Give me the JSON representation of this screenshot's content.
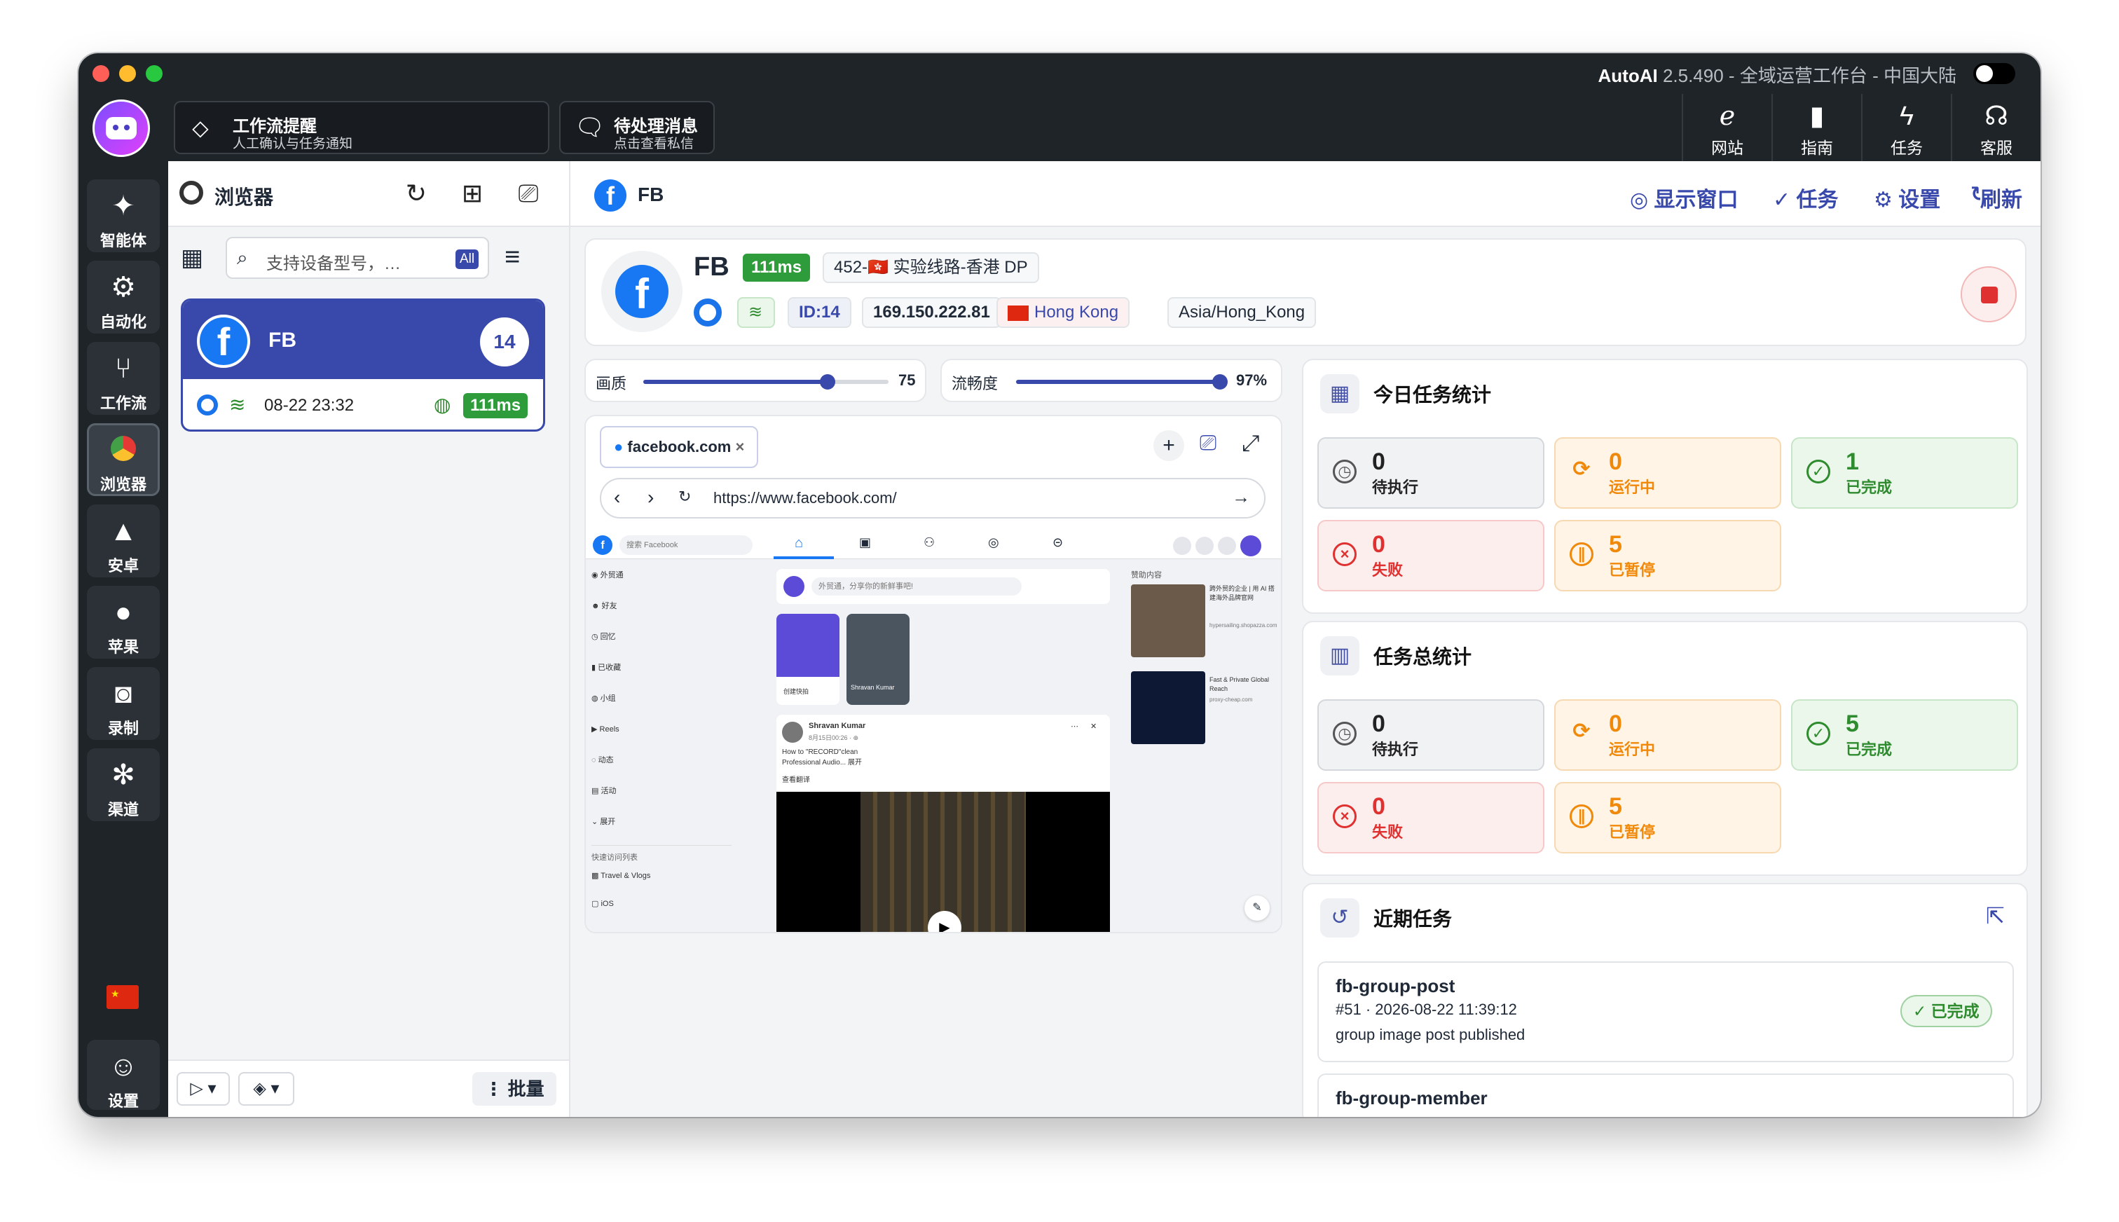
{
  "app": {
    "name": "AutoAI",
    "version": "2.5.490",
    "workspace": "全域运营工作台",
    "region": "中国大陆",
    "separator": "-"
  },
  "notices": [
    {
      "title": "工作流提醒",
      "subtitle": "人工确认与任务通知"
    },
    {
      "title": "待处理消息",
      "subtitle": "点击查看私信"
    }
  ],
  "top_buttons": [
    "网站",
    "指南",
    "任务",
    "客服"
  ],
  "nav": [
    {
      "label": "智能体",
      "icon": "sparkle-icon"
    },
    {
      "label": "自动化",
      "icon": "gear-icon"
    },
    {
      "label": "工作流",
      "icon": "branch-icon"
    },
    {
      "label": "浏览器",
      "icon": "chrome-icon"
    },
    {
      "label": "安卓",
      "icon": "android-icon"
    },
    {
      "label": "苹果",
      "icon": "apple-icon"
    },
    {
      "label": "录制",
      "icon": "camera-icon"
    },
    {
      "label": "渠道",
      "icon": "network-icon"
    }
  ],
  "settings_label": "设置",
  "list": {
    "title": "浏览器",
    "search_placeholder": "支持设备型号，…",
    "filter_badge": "All",
    "batch_label": "批量",
    "device": {
      "name": "FB",
      "count": "14",
      "time": "08-22 23:32",
      "latency": "111ms"
    }
  },
  "header": {
    "title": "FB",
    "actions": [
      "显示窗口",
      "任务",
      "设置",
      "刷新"
    ]
  },
  "profile": {
    "name": "FB",
    "latency": "111ms",
    "line": "452-🇭🇰 实验线路-香港 DP",
    "id": "ID:14",
    "ip": "169.150.222.81",
    "location": "Hong Kong",
    "timezone": "Asia/Hong_Kong"
  },
  "sliders": {
    "quality_label": "画质",
    "quality_value": "75",
    "quality": 0.75,
    "smooth_label": "流畅度",
    "smooth_value": "97%",
    "smooth": 0.97
  },
  "browser": {
    "tab": "facebook.com",
    "url": "https://www.facebook.com/",
    "fb": {
      "search": "搜索 Facebook",
      "sidebar": [
        "外贸通",
        "好友",
        "回忆",
        "已收藏",
        "小组",
        "Reels",
        "动态",
        "活动",
        "展开"
      ],
      "shortcuts_title": "快速访问列表",
      "shortcuts": [
        "Travel & Vlogs",
        "iOS"
      ],
      "composer": "外贸通，分享你的新鲜事吧!",
      "story_create": "创建快拍",
      "story_name": "Shravan Kumar",
      "post_author": "Shravan Kumar",
      "post_time": "8月15日00:26 · ⊕",
      "post_text": "How to \"RECORD\"clean Professional Audio... 展开",
      "post_translate": "查看翻译",
      "sponsored": "赞助内容",
      "ad1": "跨外贸的企业 | 用 AI 搭建海外品牌官网",
      "ad1_site": "hypersailing.shopazza.com",
      "ad2": "Fast & Private Global Reach",
      "ad2_site": "proxy-cheap.com"
    }
  },
  "today": {
    "title": "今日任务统计",
    "pending": "0",
    "pending_label": "待执行",
    "running": "0",
    "running_label": "运行中",
    "done": "1",
    "done_label": "已完成",
    "failed": "0",
    "failed_label": "失败",
    "paused": "5",
    "paused_label": "已暂停"
  },
  "total": {
    "title": "任务总统计",
    "pending": "0",
    "pending_label": "待执行",
    "running": "0",
    "running_label": "运行中",
    "done": "5",
    "done_label": "已完成",
    "failed": "0",
    "failed_label": "失败",
    "paused": "5",
    "paused_label": "已暂停"
  },
  "recent": {
    "title": "近期任务",
    "items": [
      {
        "name": "fb-group-post",
        "meta": "#51 · 2026-08-22 11:39:12",
        "desc": "group image post published",
        "status": "已完成"
      },
      {
        "name": "fb-group-member",
        "meta": "",
        "desc": "",
        "status": ""
      }
    ]
  },
  "colors": {
    "accent": "#3949ab",
    "brand_fb": "#1877f2",
    "success": "#2e8b2e",
    "warning": "#f0890a",
    "danger": "#e03131",
    "chrome_dark": "#1f2429"
  }
}
